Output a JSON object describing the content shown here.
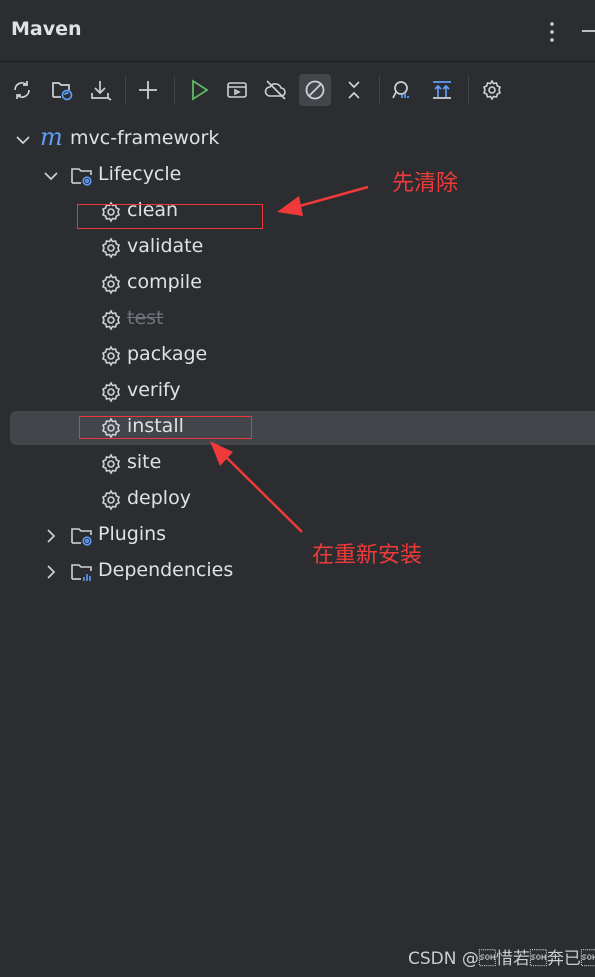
{
  "panel": {
    "title": "Maven"
  },
  "toolbar": {
    "buttons": [
      {
        "icon": "reload-icon"
      },
      {
        "icon": "generate-sources-icon"
      },
      {
        "icon": "download-icon"
      },
      {
        "icon": "add-icon"
      },
      {
        "icon": "run-icon"
      },
      {
        "icon": "execute-goal-icon"
      },
      {
        "icon": "offline-icon"
      },
      {
        "icon": "skip-tests-icon",
        "active": true
      },
      {
        "icon": "collapse-all-icon"
      },
      {
        "icon": "analyze-dependencies-icon"
      },
      {
        "icon": "show-diagram-icon"
      },
      {
        "icon": "settings-icon"
      }
    ]
  },
  "tree": {
    "project": "mvc-framework",
    "lifecycle": {
      "label": "Lifecycle",
      "goals": [
        "clean",
        "validate",
        "compile",
        "test",
        "package",
        "verify",
        "install",
        "site",
        "deploy"
      ],
      "disabled_goal": "test",
      "selected_goal": "install"
    },
    "plugins": "Plugins",
    "dependencies": "Dependencies"
  },
  "annotations": {
    "first": "先清除",
    "second": "在重新安装"
  },
  "watermark": "CSDN @\u0001惜若\u0001奔已\u0001",
  "colors": {
    "background": "#2b2d30",
    "accent": "#5f9df7",
    "run_green": "#5fb865",
    "annotation_red": "#f03a3a"
  }
}
